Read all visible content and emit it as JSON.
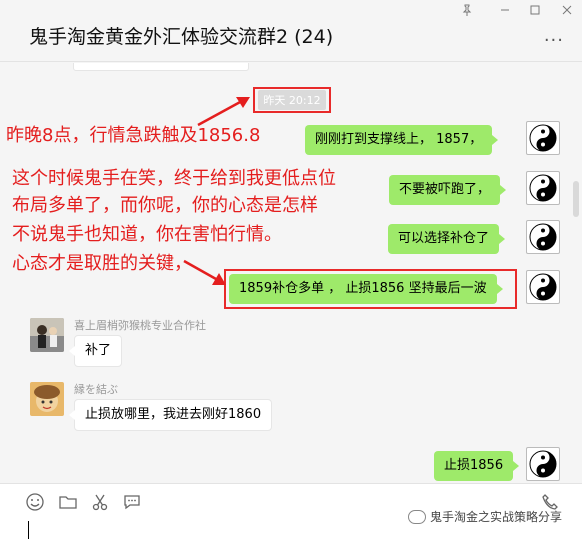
{
  "window": {
    "title": "鬼手淘金黄金外汇体验交流群2 (24)",
    "controls": [
      "pin",
      "minimize",
      "maximize",
      "close"
    ],
    "more_icon": "more-icon"
  },
  "chat": {
    "timestamp": "昨天 20:12",
    "messages": [
      {
        "side": "right",
        "text": "刚刚打到支撑线上， 1857，",
        "avatar": "yin-yang-avatar"
      },
      {
        "side": "right",
        "text": "不要被吓跑了，",
        "avatar": "yin-yang-avatar"
      },
      {
        "side": "right",
        "text": "可以选择补仓了",
        "avatar": "yin-yang-avatar"
      },
      {
        "side": "right",
        "text": "1859补仓多单 ， 止损1856   坚持最后一波",
        "avatar": "yin-yang-avatar"
      },
      {
        "side": "left",
        "sender": "喜上眉梢弥猴桃专业合作社",
        "text": "补了",
        "avatar": "person-photo-avatar"
      },
      {
        "side": "left",
        "sender": "縁を結ぶ",
        "text": "止损放哪里，我进去刚好1860",
        "avatar": "cartoon-avatar"
      },
      {
        "side": "right",
        "text": "止损1856",
        "avatar": "yin-yang-avatar"
      }
    ]
  },
  "annotations": {
    "line1": "昨晚8点，行情急跌触及1856.8",
    "line2": "这个时候鬼手在笑，终于给到我更低点位",
    "line3": "布局多单了，而你呢，你的心态是怎样",
    "line4": "不说鬼手也知道，你在害怕行情。",
    "line5": "心态才是取胜的关键，",
    "color": "#e41e1e"
  },
  "toolbar": {
    "icons": [
      "emoji-icon",
      "folder-icon",
      "scissors-icon",
      "chat-bubble-icon",
      "phone-icon"
    ]
  },
  "watermark": {
    "text": "鬼手淘金之实战策略分享"
  },
  "colors": {
    "my_bubble": "#9eea6a",
    "highlight": "#e82a2a",
    "background": "#f5f5f5"
  }
}
